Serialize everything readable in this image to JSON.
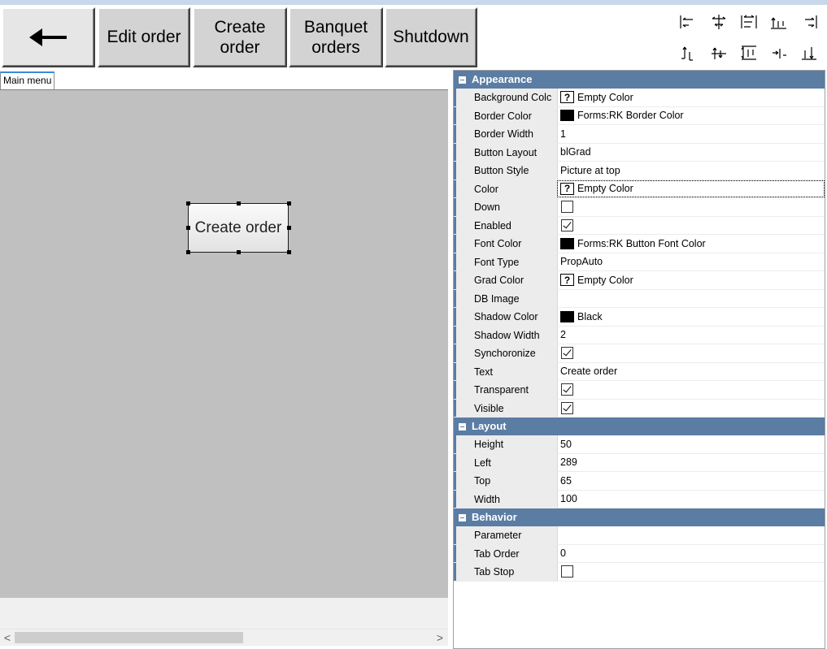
{
  "toolbar": {
    "back_icon": "left-arrow-icon",
    "edit_order": "Edit order",
    "create_order": "Create\norder",
    "banquet_orders": "Banquet\norders",
    "shutdown": "Shutdown"
  },
  "align_tools": [
    "align-left-edges-icon",
    "align-horizontal-centers-icon",
    "space-equally-horizontal-icon",
    "align-bottom-spacing-icon",
    "align-right-edges-icon",
    "align-top-edges-icon",
    "align-vertical-centers-icon",
    "space-equally-vertical-icon",
    "center-horizontally-icon",
    "align-bottom-edges-icon"
  ],
  "designer": {
    "tab_label": "Main menu",
    "selected_button_text": "Create order",
    "scroll_left": "<",
    "scroll_right": ">"
  },
  "property_grid": {
    "categories": [
      {
        "name": "Appearance",
        "rows": [
          {
            "name": "Background Colc",
            "kind": "qcolor",
            "value": "Empty Color"
          },
          {
            "name": "Border Color",
            "kind": "color",
            "value": "Forms:RK Border Color",
            "color": "#000000"
          },
          {
            "name": "Border Width",
            "kind": "text",
            "value": "1"
          },
          {
            "name": "Button Layout",
            "kind": "text",
            "value": "blGrad"
          },
          {
            "name": "Button Style",
            "kind": "text",
            "value": "Picture at top"
          },
          {
            "name": "Color",
            "kind": "qcolor",
            "value": "Empty Color",
            "selected": true
          },
          {
            "name": "Down",
            "kind": "check",
            "checked": false
          },
          {
            "name": "Enabled",
            "kind": "check",
            "checked": true
          },
          {
            "name": "Font Color",
            "kind": "color",
            "value": "Forms:RK Button Font Color",
            "color": "#000000"
          },
          {
            "name": "Font Type",
            "kind": "text",
            "value": "PropAuto"
          },
          {
            "name": "Grad Color",
            "kind": "qcolor",
            "value": "Empty Color"
          },
          {
            "name": "DB Image",
            "kind": "text",
            "value": ""
          },
          {
            "name": "Shadow Color",
            "kind": "color",
            "value": "Black",
            "color": "#000000"
          },
          {
            "name": "Shadow Width",
            "kind": "text",
            "value": "2"
          },
          {
            "name": "Synchoronize",
            "kind": "check",
            "checked": true
          },
          {
            "name": "Text",
            "kind": "text",
            "value": "Create order"
          },
          {
            "name": "Transparent",
            "kind": "check",
            "checked": true
          },
          {
            "name": "Visible",
            "kind": "check",
            "checked": true
          }
        ]
      },
      {
        "name": "Layout",
        "rows": [
          {
            "name": "Height",
            "kind": "text",
            "value": "50"
          },
          {
            "name": "Left",
            "kind": "text",
            "value": "289"
          },
          {
            "name": "Top",
            "kind": "text",
            "value": "65"
          },
          {
            "name": "Width",
            "kind": "text",
            "value": "100"
          }
        ]
      },
      {
        "name": "Behavior",
        "rows": [
          {
            "name": "Parameter",
            "kind": "text",
            "value": ""
          },
          {
            "name": "Tab Order",
            "kind": "text",
            "value": "0"
          },
          {
            "name": "Tab Stop",
            "kind": "check",
            "checked": false
          }
        ]
      }
    ]
  }
}
